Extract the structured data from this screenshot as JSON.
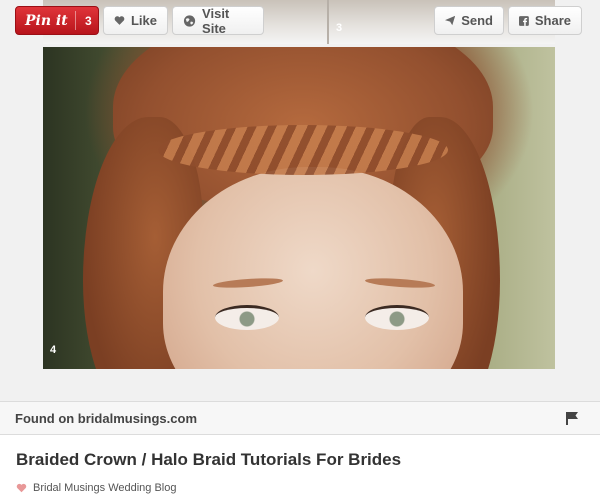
{
  "toolbar": {
    "pin_label": "Pin it",
    "pin_count": "3",
    "like_label": "Like",
    "visit_label": "Visit Site",
    "send_label": "Send",
    "share_label": "Share",
    "image_number_top": "3"
  },
  "image": {
    "number": "4"
  },
  "source": {
    "text": "Found on bridalmusings.com",
    "flag_icon": "flag-icon"
  },
  "pin": {
    "title": "Braided Crown / Halo Braid Tutorials For Brides",
    "board": "Bridal Musings Wedding Blog",
    "heart_icon": "heart-icon"
  },
  "colors": {
    "pin_red": "#cb2027",
    "heart": "#e89898",
    "background": "#f1f1f1"
  }
}
